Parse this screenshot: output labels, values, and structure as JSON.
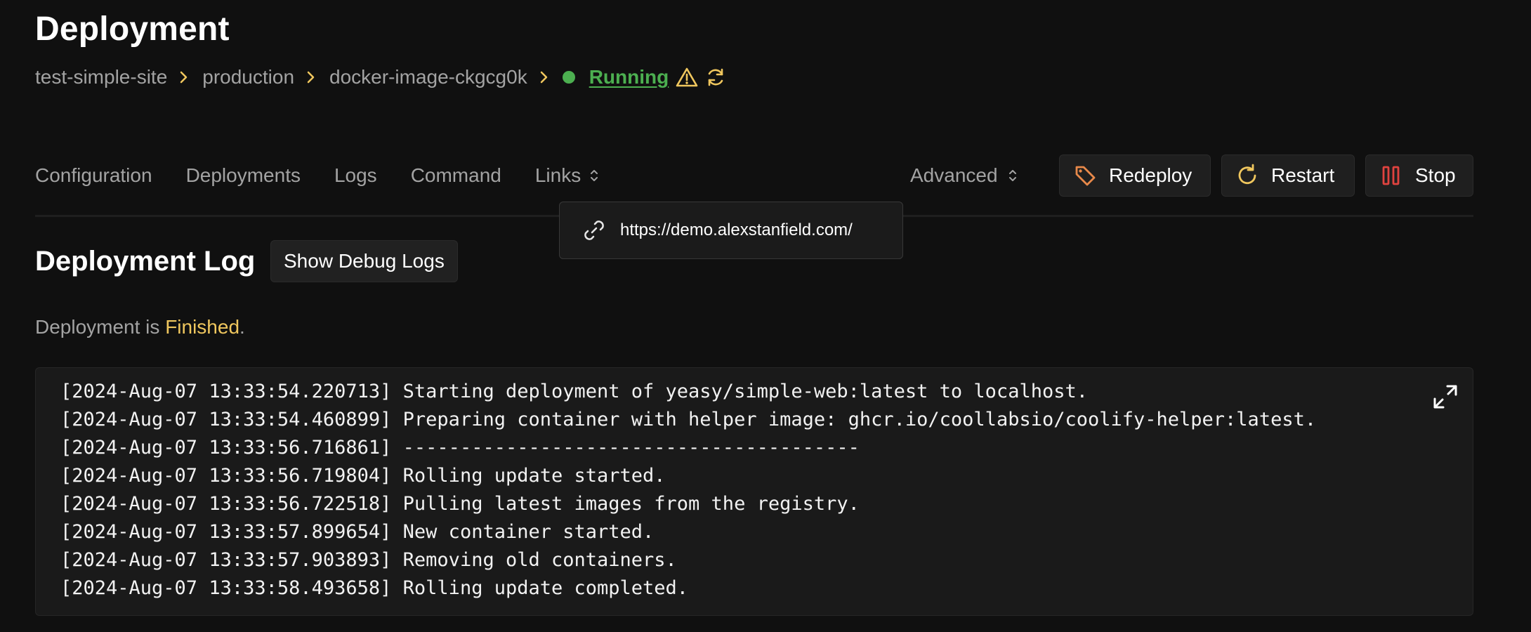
{
  "page": {
    "title": "Deployment"
  },
  "breadcrumb": {
    "items": [
      "test-simple-site",
      "production",
      "docker-image-ckgcg0k"
    ],
    "status": "Running"
  },
  "tabs": [
    {
      "label": "Configuration"
    },
    {
      "label": "Deployments"
    },
    {
      "label": "Logs"
    },
    {
      "label": "Command"
    },
    {
      "label": "Links"
    }
  ],
  "toolbar": {
    "advanced_label": "Advanced",
    "redeploy_label": "Redeploy",
    "restart_label": "Restart",
    "stop_label": "Stop"
  },
  "links_popup": {
    "url": "https://demo.alexstanfield.com/"
  },
  "deployment_log": {
    "title": "Deployment Log",
    "debug_button": "Show Debug Logs",
    "status_prefix": "Deployment is ",
    "status_value": "Finished",
    "status_suffix": ".",
    "lines": [
      "[2024-Aug-07 13:33:54.220713] Starting deployment of yeasy/simple-web:latest to localhost.",
      "[2024-Aug-07 13:33:54.460899] Preparing container with helper image: ghcr.io/coollabsio/coolify-helper:latest.",
      "[2024-Aug-07 13:33:56.716861] ----------------------------------------",
      "[2024-Aug-07 13:33:56.719804] Rolling update started.",
      "[2024-Aug-07 13:33:56.722518] Pulling latest images from the registry.",
      "[2024-Aug-07 13:33:57.899654] New container started.",
      "[2024-Aug-07 13:33:57.903893] Removing old containers.",
      "[2024-Aug-07 13:33:58.493658] Rolling update completed."
    ]
  },
  "colors": {
    "background": "#101010",
    "accent_yellow": "#f0c75e",
    "running_green": "#4caf50",
    "redeploy_orange": "#e8894a",
    "stop_red": "#e0433f"
  },
  "icons": {
    "status": "status-dot",
    "warning": "warning-icon",
    "refresh": "refresh-icon",
    "redeploy": "tag-icon",
    "restart": "restart-icon",
    "stop": "pause-icon",
    "link": "link-icon",
    "expand": "expand-icon"
  }
}
